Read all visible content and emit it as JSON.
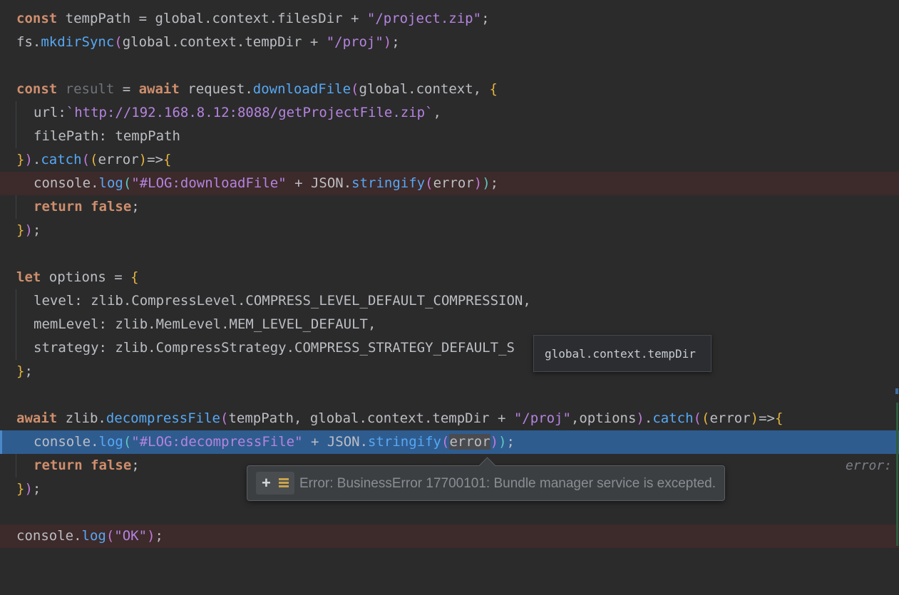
{
  "code": {
    "l1": {
      "a": "const",
      "b": " tempPath = global.",
      "c": "context",
      ".filesDir": ".filesDir + ",
      "s": "\"/project.zip\"",
      "e": ";"
    },
    "l2": {
      "a": "fs.",
      "fn": "mkdirSync",
      "p1": "(",
      "b": "global.context.tempDir + ",
      "s": "\"/proj\"",
      "p2": ")",
      "e": ";"
    },
    "l4": {
      "kw1": "const",
      "dim": " result",
      "b": " = ",
      "kw2": "await",
      "c": " request.",
      "fn": "downloadFile",
      "p1": "(",
      "d": "global.context, ",
      "p2": "{"
    },
    "l5": {
      "a": "url:",
      "s": "`http://192.168.8.12:8088/getProjectFile.zip`",
      "e": ","
    },
    "l6": {
      "a": "filePath: tempPath"
    },
    "l7": {
      "p1": "}",
      "p2": ")",
      ".": ".",
      "fn": "catch",
      "p3": "(",
      "p4": "(",
      "a": "error",
      "p5": ")",
      "b": "=>",
      "p6": "{"
    },
    "l8": {
      "a": "console.",
      "fn": "log",
      "p1": "(",
      "s": "\"#LOG:downloadFile\"",
      "b": " + JSON.",
      "fn2": "stringify",
      "p2": "(",
      "c": "error",
      "p3": ")",
      "p4": ")",
      "e": ";"
    },
    "l9": {
      "kw": "return false",
      "e": ";"
    },
    "l10": {
      "p1": "}",
      "p2": ")",
      "e": ";"
    },
    "l12": {
      "kw": "let",
      "a": " options = ",
      "p": "{"
    },
    "l13": {
      "a": "level: zlib.CompressLevel.COMPRESS_LEVEL_DEFAULT_COMPRESSION,"
    },
    "l14": {
      "a": "memLevel: zlib.MemLevel.MEM_LEVEL_DEFAULT,"
    },
    "l15": {
      "a": "strategy: zlib.CompressStrategy.COMPRESS_STRATEGY_DEFAULT_S"
    },
    "l16": {
      "p": "}",
      "e": ";"
    },
    "l18": {
      "kw": "await",
      "a": " zlib.",
      "fn": "decompressFile",
      "p1": "(",
      "b": "tempPath, global.context.tempDir + ",
      "s": "\"/proj\"",
      "c": ",options",
      "p2": ")",
      ".": ".",
      "fn2": "catch",
      "p3": "(",
      "p4": "(",
      "d": "error",
      "p5": ")",
      "e": "=>",
      "p6": "{",
      "inlay": "error:"
    },
    "l19": {
      "a": "console.",
      "fn": "log",
      "p1": "(",
      "s": "\"#LOG:decompressFile\"",
      "b": " + JSON.",
      "fn2": "stringify",
      "p2": "(",
      "c": "error",
      "p3": ")",
      "p4": ")",
      "e": ";"
    },
    "l20": {
      "kw": "return false",
      "e": ";"
    },
    "l21": {
      "p1": "}",
      "p2": ")",
      "e": ";"
    },
    "l23": {
      "a": "console.",
      "fn": "log",
      "p1": "(",
      "s": "\"OK\"",
      "p2": ")",
      "e": ";"
    }
  },
  "tooltip_eval": {
    "text": "global.context.tempDir"
  },
  "tooltip_error": {
    "message": "Error: BusinessError 17700101: Bundle manager service is excepted.",
    "plus": "+"
  },
  "colors": {
    "background": "#2b2b2b",
    "keyword": "#cf8e6d",
    "string": "#b583e0",
    "function": "#56a8f5",
    "execution_line": "#2f5c8f",
    "breakpoint_line": "#3d2a2a"
  }
}
